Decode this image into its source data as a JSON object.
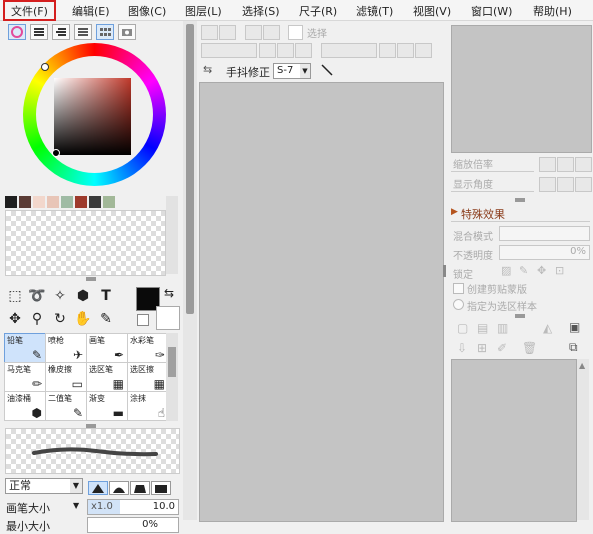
{
  "menu": [
    "文件(F)",
    "编辑(E)",
    "图像(C)",
    "图层(L)",
    "选择(S)",
    "尺子(R)",
    "滤镜(T)",
    "视图(V)",
    "窗口(W)",
    "帮助(H)"
  ],
  "palette_colors": [
    "#1f1f1f",
    "#5a3b35",
    "#f2d7cc",
    "#e8c5b7",
    "#9fbba4",
    "#9d3a2c",
    "#3a3a3a",
    "#a2b898"
  ],
  "colors": {
    "primary": "#0a0a0a",
    "secondary": "#ffffff",
    "hue_box": "#c0392b",
    "canvas": "#c4c4c4",
    "menu_highlight": "#d41f1f",
    "selected_brush": "#cfe3fb",
    "effects_arrow": "#b5541e",
    "effects_title": "#8a3b1a"
  },
  "tools": [
    {
      "name": "rect-select-icon",
      "glyph": "⬚"
    },
    {
      "name": "lasso-icon",
      "glyph": "➰"
    },
    {
      "name": "magic-wand-icon",
      "glyph": "✧"
    },
    {
      "name": "bucket-icon",
      "glyph": "⬢"
    },
    {
      "name": "text-tool-icon",
      "glyph": "T"
    },
    {
      "name": "move-icon",
      "glyph": "✥"
    },
    {
      "name": "zoom-icon",
      "glyph": "⚲"
    },
    {
      "name": "rotate-icon",
      "glyph": "↻"
    },
    {
      "name": "hand-icon",
      "glyph": "✋"
    },
    {
      "name": "eyedropper-icon",
      "glyph": "✎"
    }
  ],
  "brushes": [
    {
      "label": "铅笔",
      "icon": "✎"
    },
    {
      "label": "喷枪",
      "icon": "✈"
    },
    {
      "label": "画笔",
      "icon": "✒"
    },
    {
      "label": "水彩笔",
      "icon": "✑"
    },
    {
      "label": "马克笔",
      "icon": "✏"
    },
    {
      "label": "橡皮擦",
      "icon": "▭"
    },
    {
      "label": "选区笔",
      "icon": "▦"
    },
    {
      "label": "选区擦",
      "icon": "▦"
    },
    {
      "label": "油漆桶",
      "icon": "⬢"
    },
    {
      "label": "二值笔",
      "icon": "✎"
    },
    {
      "label": "渐变",
      "icon": "▬"
    },
    {
      "label": "涂抹",
      "icon": "☝"
    }
  ],
  "blend_mode": "正常",
  "brush_size_label": "画笔大小",
  "brush_size_multiplier": "x1.0",
  "brush_size_value": "10.0",
  "min_size_label": "最小大小",
  "min_size_value": "0%",
  "toolbar": {
    "select_label": "选择",
    "stabilizer_label": "手抖修正",
    "stabilizer_value": "S-7"
  },
  "nav": {
    "zoom_label": "缩放倍率",
    "angle_label": "显示角度"
  },
  "layers": {
    "effects_title": "特殊效果",
    "blend_label": "混合模式",
    "opacity_label": "不透明度",
    "opacity_value": "0%",
    "lock_label": "锁定",
    "clipping_label": "创建剪贴蒙版",
    "selection_source_label": "指定为选区样本"
  }
}
